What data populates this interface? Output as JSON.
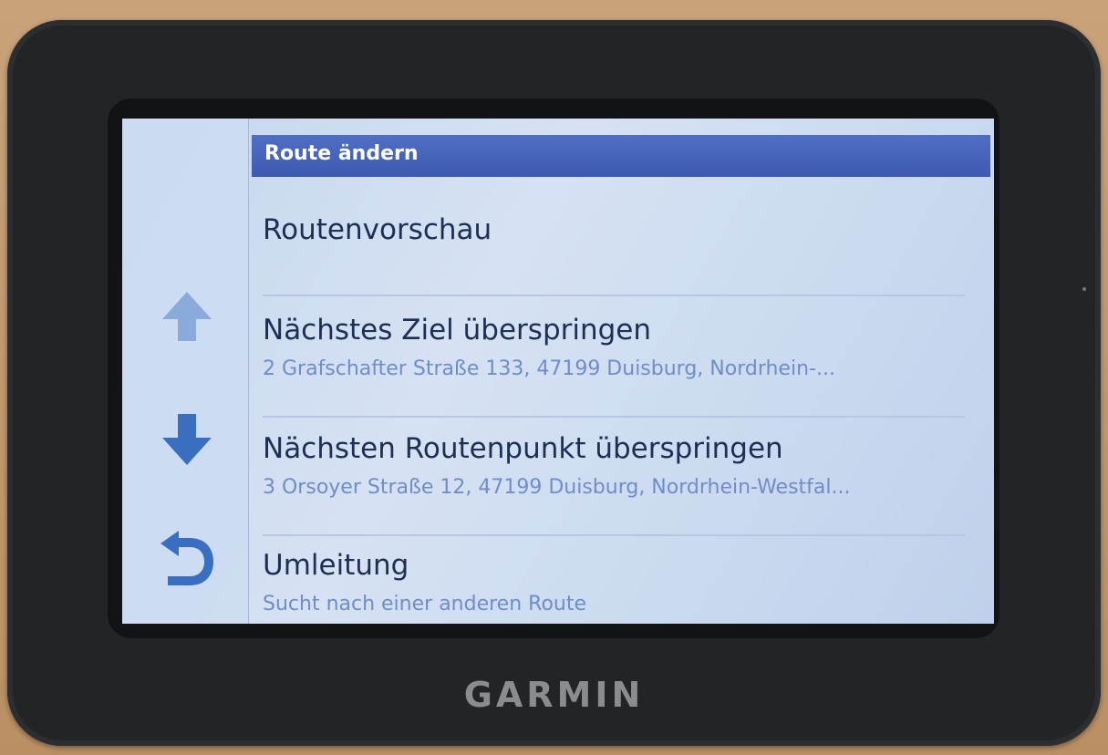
{
  "device": {
    "brand": "GARMIN"
  },
  "titlebar": {
    "title": "Route ändern"
  },
  "menu": {
    "items": [
      {
        "label": "Routenvorschau",
        "sub": ""
      },
      {
        "label": "Nächstes Ziel überspringen",
        "sub": "2 Grafschafter Straße 133, 47199 Duisburg, Nordrhein-..."
      },
      {
        "label": "Nächsten Routenpunkt überspringen",
        "sub": "3 Orsoyer Straße 12, 47199 Duisburg, Nordrhein-Westfal..."
      },
      {
        "label": "Umleitung",
        "sub": "Sucht nach einer anderen Route"
      }
    ]
  },
  "sidebar": {
    "icons": [
      "arrow-up-icon",
      "arrow-down-icon",
      "back-icon"
    ]
  },
  "colors": {
    "accent": "#3e5ab0",
    "icon_blue": "#3a6fc0",
    "label_text": "#1d2f52",
    "sub_text": "#6f8dc9"
  }
}
